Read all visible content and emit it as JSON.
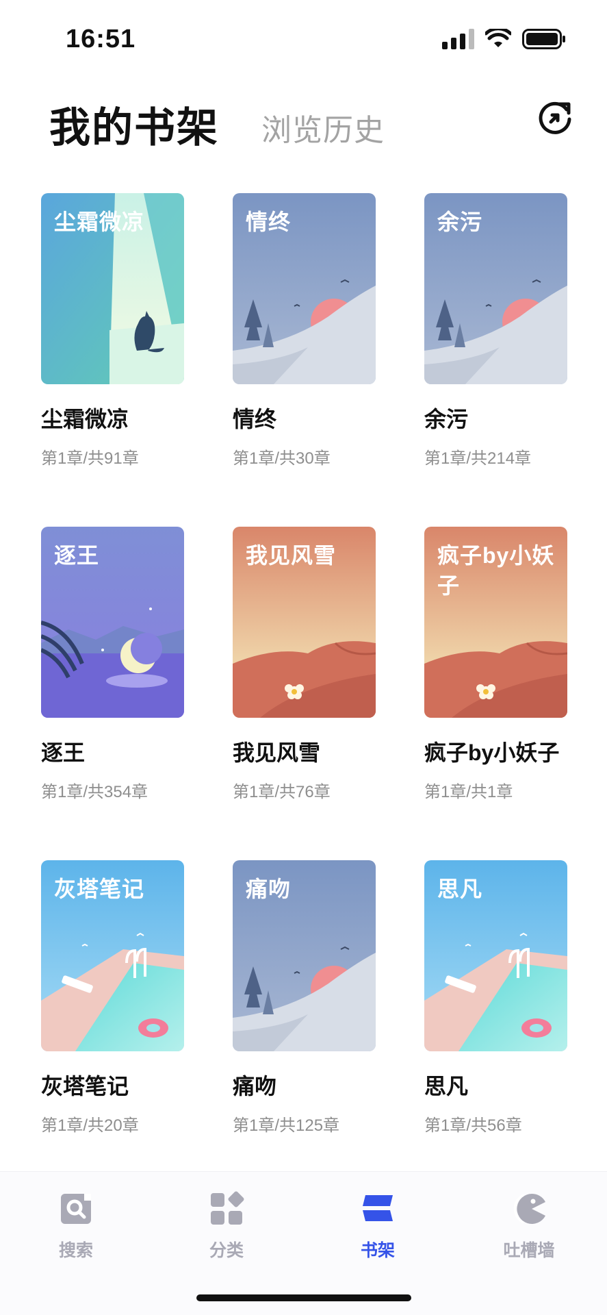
{
  "status_bar": {
    "time": "16:51"
  },
  "header": {
    "title": "我的书架",
    "history_tab": "浏览历史"
  },
  "books": [
    {
      "cover_title": "尘霜微凉",
      "name": "尘霜微凉",
      "progress": "第1章/共91章",
      "cover_style": "window-cat"
    },
    {
      "cover_title": "情终",
      "name": "情终",
      "progress": "第1章/共30章",
      "cover_style": "snow-sunset"
    },
    {
      "cover_title": "余污",
      "name": "余污",
      "progress": "第1章/共214章",
      "cover_style": "snow-sunset"
    },
    {
      "cover_title": "逐王",
      "name": "逐王",
      "progress": "第1章/共354章",
      "cover_style": "moon-night"
    },
    {
      "cover_title": "我见风雪",
      "name": "我见风雪",
      "progress": "第1章/共76章",
      "cover_style": "desert"
    },
    {
      "cover_title": "疯子by小妖子",
      "name": "疯子by小妖子",
      "progress": "第1章/共1章",
      "cover_style": "desert"
    },
    {
      "cover_title": "灰塔笔记",
      "name": "灰塔笔记",
      "progress": "第1章/共20章",
      "cover_style": "pool"
    },
    {
      "cover_title": "痛吻",
      "name": "痛吻",
      "progress": "第1章/共125章",
      "cover_style": "snow-sunset"
    },
    {
      "cover_title": "思凡",
      "name": "思凡",
      "progress": "第1章/共56章",
      "cover_style": "pool"
    }
  ],
  "tab_bar": {
    "items": [
      {
        "label": "搜索",
        "icon": "search-icon",
        "active": false
      },
      {
        "label": "分类",
        "icon": "category-icon",
        "active": false
      },
      {
        "label": "书架",
        "icon": "bookshelf-icon",
        "active": true
      },
      {
        "label": "吐槽墙",
        "icon": "comment-wall-icon",
        "active": false
      }
    ]
  },
  "colors": {
    "accent": "#3553e8",
    "inactive_tab": "#a9a9b5",
    "secondary_text": "#8e8e8e"
  }
}
